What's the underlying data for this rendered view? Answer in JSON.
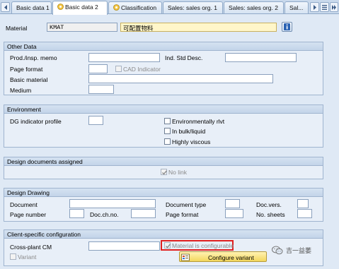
{
  "tabs": [
    {
      "label": "Basic data 1",
      "active": false
    },
    {
      "label": "Basic data 2",
      "active": true
    },
    {
      "label": "Classification",
      "active": false
    },
    {
      "label": "Sales: sales org. 1",
      "active": false
    },
    {
      "label": "Sales: sales org. 2",
      "active": false
    },
    {
      "label": "Sal...",
      "active": false
    }
  ],
  "header": {
    "material_label": "Material",
    "material_value": "KMAT",
    "material_description": "可配置物料"
  },
  "other_data": {
    "title": "Other Data",
    "prod_memo_label": "Prod./insp. memo",
    "ind_std_desc_label": "Ind. Std Desc.",
    "page_format_label": "Page format",
    "cad_indicator_label": "CAD Indicator",
    "basic_material_label": "Basic material",
    "medium_label": "Medium"
  },
  "environment": {
    "title": "Environment",
    "dg_indicator_label": "DG indicator profile",
    "env_relevant_label": "Environmentally rlvt",
    "in_bulk_label": "In bulk/liquid",
    "highly_viscous_label": "Highly viscous"
  },
  "design_docs": {
    "title": "Design documents assigned",
    "no_link_label": "No link",
    "no_link_checked": true
  },
  "design_drawing": {
    "title": "Design Drawing",
    "document_label": "Document",
    "document_type_label": "Document type",
    "doc_vers_label": "Doc.vers.",
    "page_number_label": "Page number",
    "doc_ch_no_label": "Doc.ch.no.",
    "page_format_label": "Page format",
    "no_sheets_label": "No. sheets"
  },
  "client_config": {
    "title": "Client-specific configuration",
    "cross_plant_label": "Cross-plant CM",
    "material_configurable_label": "Material is configurable",
    "material_configurable_checked": true,
    "variant_label": "Variant",
    "configure_variant_label": "Configure variant"
  },
  "watermark": {
    "text": "吉一益萎"
  },
  "colors": {
    "highlight_box": "#e02020",
    "accent_tab": "#ffffff",
    "configure_button": "#f3d75c"
  }
}
